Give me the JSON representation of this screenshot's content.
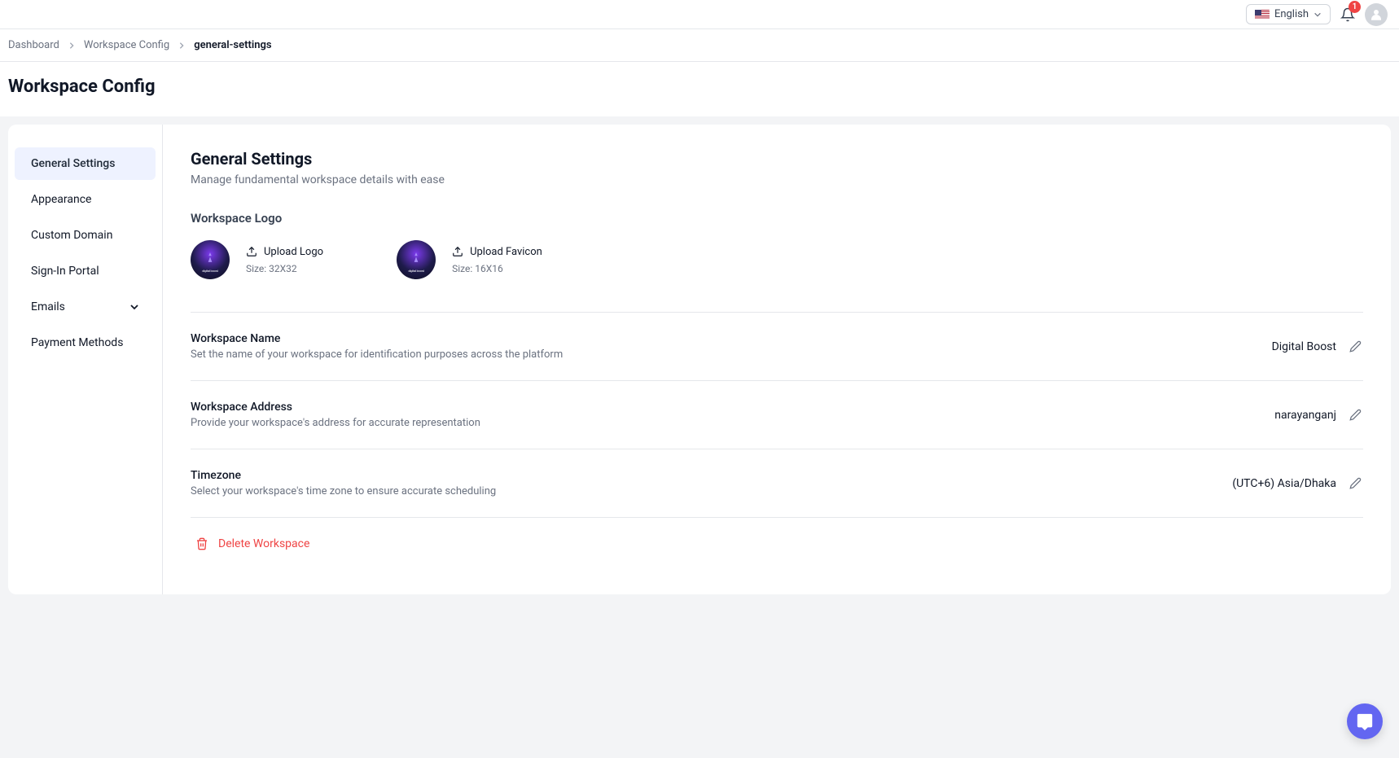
{
  "header": {
    "language": "English",
    "notification_count": "1"
  },
  "breadcrumbs": {
    "items": [
      {
        "label": "Dashboard"
      },
      {
        "label": "Workspace Config"
      },
      {
        "label": "general-settings"
      }
    ]
  },
  "page_title": "Workspace Config",
  "sidebar": {
    "items": [
      {
        "label": "General Settings"
      },
      {
        "label": "Appearance"
      },
      {
        "label": "Custom Domain"
      },
      {
        "label": "Sign-In Portal"
      },
      {
        "label": "Emails"
      },
      {
        "label": "Payment Methods"
      }
    ]
  },
  "main": {
    "title": "General Settings",
    "subtitle": "Manage fundamental workspace details with ease",
    "logo_section_title": "Workspace Logo",
    "upload_logo_label": "Upload Logo",
    "logo_size": "Size: 32X32",
    "upload_favicon_label": "Upload Favicon",
    "favicon_size": "Size: 16X16",
    "rows": [
      {
        "title": "Workspace Name",
        "desc": "Set the name of your workspace for identification purposes across the platform",
        "value": "Digital Boost"
      },
      {
        "title": "Workspace Address",
        "desc": "Provide your workspace's address for accurate representation",
        "value": "narayanganj"
      },
      {
        "title": "Timezone",
        "desc": "Select your workspace's time zone to ensure accurate scheduling",
        "value": "(UTC+6) Asia/Dhaka"
      }
    ],
    "delete_label": "Delete Workspace"
  }
}
